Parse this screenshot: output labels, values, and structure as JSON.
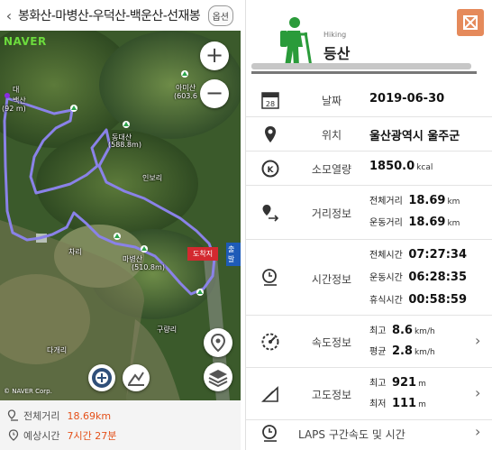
{
  "left": {
    "header": {
      "back_icon": "chevron-left-icon",
      "title": "봉화산-마병산-우덕산-백운산-선재봉",
      "option_label": "옵션"
    },
    "map": {
      "brand": "NAVER",
      "zoom_in": "+",
      "zoom_out": "−",
      "labels": [
        "아미산",
        "(603.6",
        "동대산",
        "(588.8m)",
        "인보리",
        "마병산",
        "(510.8m)",
        "차리",
        "구량리",
        "다개리",
        "대",
        "백산",
        "(92 m)"
      ],
      "finish_tag": "도착지",
      "start_tag": "출발",
      "copyright": "© NAVER Corp."
    },
    "info": {
      "total_distance_label": "전체거리",
      "total_distance_value": "18.69km",
      "expected_time_label": "예상시간",
      "expected_time_value": "7시간 27분"
    }
  },
  "right": {
    "sport_en": "Hiking",
    "sport_ko": "등산",
    "rows": {
      "date": {
        "label": "날짜",
        "value": "2019-06-30",
        "icon_text": "28"
      },
      "location": {
        "label": "위치",
        "value": "울산광역시 울주군"
      },
      "calories": {
        "label": "소모열량",
        "value": "1850.0",
        "unit": "kcal"
      },
      "distance": {
        "label": "거리정보",
        "total_key": "전체거리",
        "total_val": "18.69",
        "total_unit": "km",
        "moving_key": "운동거리",
        "moving_val": "18.69",
        "moving_unit": "km"
      },
      "time": {
        "label": "시간정보",
        "total_key": "전체시간",
        "total_val": "07:27:34",
        "moving_key": "운동시간",
        "moving_val": "06:28:35",
        "rest_key": "휴식시간",
        "rest_val": "00:58:59"
      },
      "speed": {
        "label": "속도정보",
        "max_key": "최고",
        "max_val": "8.6",
        "max_unit": "km/h",
        "avg_key": "평균",
        "avg_val": "2.8",
        "avg_unit": "km/h"
      },
      "altitude": {
        "label": "고도정보",
        "max_key": "최고",
        "max_val": "921",
        "max_unit": "m",
        "min_key": "최저",
        "min_val": "111",
        "min_unit": "m"
      },
      "laps": {
        "label": "LAPS 구간속도 및 시간"
      }
    },
    "colors": {
      "accent": "#e4511a",
      "hiker_green": "#2a9b3a",
      "share_orange": "#e58a5b"
    }
  }
}
